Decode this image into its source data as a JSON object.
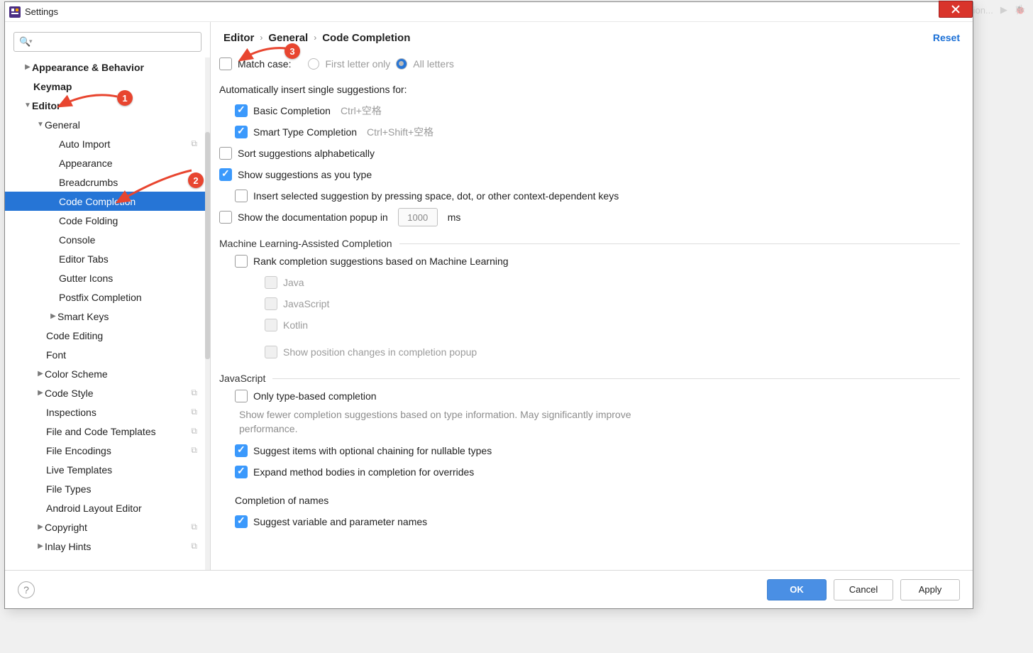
{
  "bg_toolbar": {
    "add_config": "Add Configuration..."
  },
  "titlebar": {
    "title": "Settings"
  },
  "sidebar": {
    "search_placeholder": "",
    "items": [
      {
        "label": "Appearance & Behavior",
        "level": 0,
        "arrow": "▶",
        "bold": true
      },
      {
        "label": "Keymap",
        "level": 0,
        "arrow": "",
        "bold": true
      },
      {
        "label": "Editor",
        "level": 0,
        "arrow": "▼",
        "bold": true
      },
      {
        "label": "General",
        "level": 1,
        "arrow": "▼"
      },
      {
        "label": "Auto Import",
        "level": 2,
        "copy": true
      },
      {
        "label": "Appearance",
        "level": 2
      },
      {
        "label": "Breadcrumbs",
        "level": 2
      },
      {
        "label": "Code Completion",
        "level": 2,
        "selected": true
      },
      {
        "label": "Code Folding",
        "level": 2
      },
      {
        "label": "Console",
        "level": 2
      },
      {
        "label": "Editor Tabs",
        "level": 2
      },
      {
        "label": "Gutter Icons",
        "level": 2
      },
      {
        "label": "Postfix Completion",
        "level": 2
      },
      {
        "label": "Smart Keys",
        "level": 2,
        "arrow": "▶"
      },
      {
        "label": "Code Editing",
        "level": 1
      },
      {
        "label": "Font",
        "level": 1
      },
      {
        "label": "Color Scheme",
        "level": 1,
        "arrow": "▶"
      },
      {
        "label": "Code Style",
        "level": 1,
        "arrow": "▶",
        "copy": true
      },
      {
        "label": "Inspections",
        "level": 1,
        "copy": true
      },
      {
        "label": "File and Code Templates",
        "level": 1,
        "copy": true
      },
      {
        "label": "File Encodings",
        "level": 1,
        "copy": true
      },
      {
        "label": "Live Templates",
        "level": 1
      },
      {
        "label": "File Types",
        "level": 1
      },
      {
        "label": "Android Layout Editor",
        "level": 1
      },
      {
        "label": "Copyright",
        "level": 1,
        "arrow": "▶",
        "copy": true
      },
      {
        "label": "Inlay Hints",
        "level": 1,
        "arrow": "▶",
        "copy": true
      }
    ]
  },
  "breadcrumb": {
    "p1": "Editor",
    "p2": "General",
    "p3": "Code Completion",
    "reset": "Reset"
  },
  "settings": {
    "match_case": "Match case:",
    "first_letter": "First letter only",
    "all_letters": "All letters",
    "auto_insert": "Automatically insert single suggestions for:",
    "basic": "Basic Completion",
    "basic_sc": "Ctrl+空格",
    "smart": "Smart Type Completion",
    "smart_sc": "Ctrl+Shift+空格",
    "sort_alpha": "Sort suggestions alphabetically",
    "show_type": "Show suggestions as you type",
    "insert_selected": "Insert selected suggestion by pressing space, dot, or other context-dependent keys",
    "show_doc": "Show the documentation popup in",
    "doc_ms_value": "1000",
    "ms": "ms",
    "ml_heading": "Machine Learning-Assisted Completion",
    "rank_ml": "Rank completion suggestions based on Machine Learning",
    "java": "Java",
    "javascript": "JavaScript",
    "kotlin": "Kotlin",
    "show_pos": "Show position changes in completion popup",
    "js_heading": "JavaScript",
    "only_type": "Only type-based completion",
    "only_type_hint": "Show fewer completion suggestions based on type information. May significantly improve performance.",
    "suggest_optional": "Suggest items with optional chaining for nullable types",
    "expand_bodies": "Expand method bodies in completion for overrides",
    "completion_names": "Completion of names",
    "suggest_var": "Suggest variable and parameter names"
  },
  "footer": {
    "ok": "OK",
    "cancel": "Cancel",
    "apply": "Apply"
  },
  "annotations": {
    "b1": "1",
    "b2": "2",
    "b3": "3"
  }
}
